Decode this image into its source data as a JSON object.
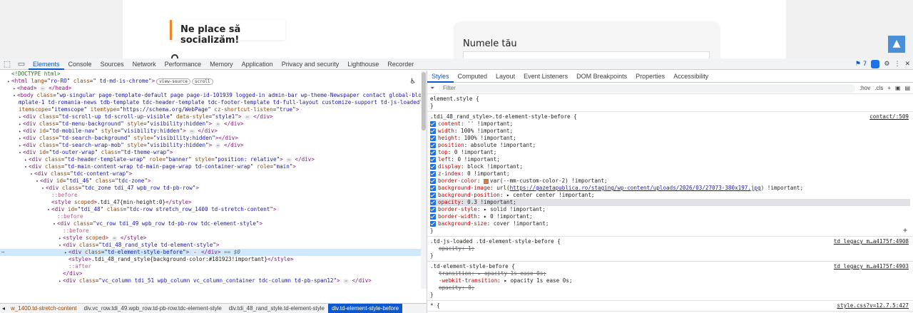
{
  "page": {
    "social_heading": "Ne place să socializăm!",
    "form_label": "Numele tău",
    "scroll_top": "▲"
  },
  "devtools": {
    "tabs": [
      "Elements",
      "Console",
      "Sources",
      "Network",
      "Performance",
      "Memory",
      "Application",
      "Privacy and security",
      "Lighthouse",
      "Recorder"
    ],
    "active_tab": "Elements",
    "issues_count": "7",
    "tree": [
      {
        "indent": 0,
        "html": "<span class='cm'>&lt;!DOCTYPE html&gt;</span>"
      },
      {
        "indent": 0,
        "tw": "▸",
        "html": "<span class='tg'>&lt;html</span> <span class='an'>lang</span>=\"<span class='av'>ro-RO</span>\" <span class='an'>class</span>=\"<span class='av'> td-md-is-chrome</span>\"<span class='tg'>&gt;</span><span class='pill'>view-source</span><span class='pill'>scroll</span>"
      },
      {
        "indent": 1,
        "tw": "▸",
        "html": "<span class='tg'>&lt;head&gt;</span> <span class='ellip'>⋯</span> <span class='tg'>&lt;/head&gt;</span>"
      },
      {
        "indent": 1,
        "tw": "▾",
        "html": "<span class='tg'>&lt;body</span> <span class='an'>class</span>=\"<span class='av'>wp-singular page-template-default page page-id-101939 logged-in admin-bar wp-theme-Newspaper contact global-block-te</span>"
      },
      {
        "indent": 1,
        "cont": true,
        "html": "<span class='av'>mplate-1 td-romania-news tdb-template tdc-header-template tdc-footer-template td-full-layout customize-support td-js-loaded</span>\""
      },
      {
        "indent": 1,
        "cont": true,
        "html": "<span class='an'>itemscope</span>=\"<span class='av'>itemscope</span>\" <span class='an'>itemtype</span>=\"<span class='av'>https://schema.org/WebPage</span>\" <span class='an'>cz-shortcut-listen</span>=\"<span class='av'>true</span>\"<span class='tg'>&gt;</span>"
      },
      {
        "indent": 2,
        "tw": "▸",
        "html": "<span class='tg'>&lt;div</span> <span class='an'>class</span>=\"<span class='av'>td-scroll-up td-scroll-up-visible</span>\" <span class='an'>data-style</span>=\"<span class='av'>style1</span>\"<span class='tg'>&gt;</span> <span class='ellip'>⋯</span> <span class='tg'>&lt;/div&gt;</span>"
      },
      {
        "indent": 2,
        "tw": "▸",
        "html": "<span class='tg'>&lt;div</span> <span class='an'>class</span>=\"<span class='av'>td-menu-background</span>\" <span class='an'>style</span>=\"<span class='av'>visibility:hidden</span>\"<span class='tg'>&gt;</span> <span class='ellip'>⋯</span> <span class='tg'>&lt;/div&gt;</span>"
      },
      {
        "indent": 2,
        "tw": "▸",
        "html": "<span class='tg'>&lt;div</span> <span class='an'>id</span>=\"<span class='av'>td-mobile-nav</span>\" <span class='an'>style</span>=\"<span class='av'>visibility:hidden</span>\"<span class='tg'>&gt;</span> <span class='ellip'>⋯</span> <span class='tg'>&lt;/div&gt;</span>"
      },
      {
        "indent": 2,
        "tw": "▸",
        "html": "<span class='tg'>&lt;div</span> <span class='an'>class</span>=\"<span class='av'>td-search-background</span>\" <span class='an'>style</span>=\"<span class='av'>visibility:hidden</span>\"<span class='tg'>&gt;</span><span class='tg'>&lt;/div&gt;</span>"
      },
      {
        "indent": 2,
        "tw": "▸",
        "html": "<span class='tg'>&lt;div</span> <span class='an'>class</span>=\"<span class='av'>td-search-wrap-mob</span>\" <span class='an'>style</span>=\"<span class='av'>visibility:hidden</span>\"<span class='tg'>&gt;</span> <span class='ellip'>⋯</span> <span class='tg'>&lt;/div&gt;</span>"
      },
      {
        "indent": 2,
        "tw": "▾",
        "html": "<span class='tg'>&lt;div</span> <span class='an'>id</span>=\"<span class='av'>td-outer-wrap</span>\" <span class='an'>class</span>=\"<span class='av'>td-theme-wrap</span>\"<span class='tg'>&gt;</span>"
      },
      {
        "indent": 3,
        "tw": "▸",
        "html": "<span class='tg'>&lt;div</span> <span class='an'>class</span>=\"<span class='av'>td-header-template-wrap</span>\" <span class='an'>role</span>=\"<span class='av'>banner</span>\" <span class='an'>style</span>=\"<span class='av'>position: relative</span>\"<span class='tg'>&gt;</span> <span class='ellip'>⋯</span> <span class='tg'>&lt;/div&gt;</span>"
      },
      {
        "indent": 3,
        "tw": "▾",
        "html": "<span class='tg'>&lt;div</span> <span class='an'>class</span>=\"<span class='av'>td-main-content-wrap td-main-page-wrap td-container-wrap</span>\" <span class='an'>role</span>=\"<span class='av'>main</span>\"<span class='tg'>&gt;</span>"
      },
      {
        "indent": 4,
        "tw": "▾",
        "html": "<span class='tg'>&lt;div</span> <span class='an'>class</span>=\"<span class='av'>tdc-content-wrap</span>\"<span class='tg'>&gt;</span>"
      },
      {
        "indent": 5,
        "tw": "▾",
        "html": "<span class='tg'>&lt;div</span> <span class='an'>id</span>=\"<span class='av'>tdi_46</span>\" <span class='an'>class</span>=\"<span class='av'>tdc-zone</span>\"<span class='tg'>&gt;</span>"
      },
      {
        "indent": 6,
        "tw": "▾",
        "html": "<span class='tg'>&lt;div</span> <span class='an'>class</span>=\"<span class='av'>tdc_zone tdi_47  wpb_row td-pb-row</span>\"<span class='tg'>&gt;</span>"
      },
      {
        "indent": 7,
        "html": "<span class='ps'>::before</span>"
      },
      {
        "indent": 7,
        "html": "<span class='tg'>&lt;style</span> <span class='an'>scoped</span><span class='tg'>&gt;</span>.tdi_47{min-height:0}<span class='tg'>&lt;/style&gt;</span>"
      },
      {
        "indent": 7,
        "tw": "▾",
        "html": "<span class='tg'>&lt;div</span> <span class='an'>id</span>=\"<span class='av'>tdi_48</span>\" <span class='an'>class</span>=\"<span class='av'>tdc-row stretch_row_1400 td-stretch-content</span>\"<span class='tg'>&gt;</span>"
      },
      {
        "indent": 8,
        "html": "<span class='ps'>::before</span>"
      },
      {
        "indent": 8,
        "tw": "▾",
        "html": "<span class='tg'>&lt;div</span> <span class='an'>class</span>=\"<span class='av'>vc_row tdi_49  wpb_row td-pb-row tdc-element-style</span>\"<span class='tg'>&gt;</span>"
      },
      {
        "indent": 9,
        "html": "<span class='ps'>::before</span>"
      },
      {
        "indent": 9,
        "tw": "▸",
        "html": "<span class='tg'>&lt;style</span> <span class='an'>scoped</span><span class='tg'>&gt;</span> <span class='ellip'>⋯</span> <span class='tg'>&lt;/style&gt;</span>"
      },
      {
        "indent": 9,
        "tw": "▾",
        "html": "<span class='tg'>&lt;div</span> <span class='an'>class</span>=\"<span class='av'>tdi_48_rand_style td-element-style</span>\"<span class='tg'>&gt;</span>"
      },
      {
        "indent": 10,
        "tw": "▸",
        "sel": true,
        "html": "<span class='tg'>&lt;div</span> <span class='an'>class</span>=\"<span class='av'>td-element-style-before</span>\"<span class='tg'>&gt;</span> <span class='ellip'>⋯</span> <span class='tg'>&lt;/div&gt;</span> <span class='eq0'>== $0</span>"
      },
      {
        "indent": 10,
        "html": "<span class='tg'>&lt;style&gt;</span>.tdi_48_rand_style{background-color:#181923!important}<span class='tg'>&lt;/style&gt;</span>"
      },
      {
        "indent": 10,
        "html": "<span class='ps'>::after</span>"
      },
      {
        "indent": 9,
        "html": "<span class='tg'>&lt;/div&gt;</span>"
      },
      {
        "indent": 9,
        "tw": "▸",
        "html": "<span class='tg'>&lt;div</span> <span class='an'>class</span>=\"<span class='av'>vc_column tdi_51  wpb_column vc_column_container tdc-column td-pb-span12</span>\"<span class='tg'>&gt;</span> <span class='ellip'>⋯</span> <span class='tg'>&lt;/div&gt;</span>"
      }
    ],
    "breadcrumbs": [
      "w_1400.td-stretch-content",
      "div.vc_row.tdi_49.wpb_row.td-pb-row.tdc-element-style",
      "div.tdi_48_rand_style.td-element-style",
      "div.td-element-style-before"
    ],
    "styles_tabs": [
      "Styles",
      "Computed",
      "Layout",
      "Event Listeners",
      "DOM Breakpoints",
      "Properties",
      "Accessibility"
    ],
    "filter_placeholder": "Filter",
    "filter_tools": [
      ":hov",
      ".cls",
      "+"
    ],
    "element_style_selector": "element.style {",
    "rule1": {
      "selector": ".tdi_48_rand_style>.td-element-style-before {",
      "source": "contact/:509",
      "props": [
        {
          "n": "content",
          "v": "'' !important;"
        },
        {
          "n": "width",
          "v": "100% !important;"
        },
        {
          "n": "height",
          "v": "100% !important;"
        },
        {
          "n": "position",
          "v": "absolute !important;"
        },
        {
          "n": "top",
          "v": "0 !important;"
        },
        {
          "n": "left",
          "v": "0 !important;"
        },
        {
          "n": "display",
          "v": "block !important;"
        },
        {
          "n": "z-index",
          "v": "0 !important;"
        },
        {
          "n": "border-color",
          "v": "var(--mm-custom-color-2) !important;",
          "swatch": "#e07b39"
        },
        {
          "n": "background-image",
          "v": "url(https://gazetapublica.ro/staging/wp-content/uploads/2026/03/27073-380x197.jpg) !important;",
          "link": true
        },
        {
          "n": "background-position",
          "v": "▸ center center !important;"
        },
        {
          "n": "opacity",
          "v": "0.3 !important;",
          "hi": true
        },
        {
          "n": "border-style",
          "v": "▸ solid !important;"
        },
        {
          "n": "border-width",
          "v": "▸ 0 !important;"
        },
        {
          "n": "background-size",
          "v": "cover !important;"
        }
      ]
    },
    "rule2": {
      "selector": ".td-js-loaded .td-element-style-before {",
      "source": "td_legacy_m…a4175f:4908",
      "props": [
        {
          "n": "opacity",
          "v": "1;",
          "strike": true
        }
      ]
    },
    "rule3": {
      "selector": ".td-element-style-before {",
      "source": "td_legacy_m…a4175f:4903",
      "props": [
        {
          "n": "transition",
          "v": "▸ opacity 1s ease 0s;",
          "strike": true
        },
        {
          "n": "-webkit-transition",
          "v": "▸ opacity 1s ease 0s;"
        },
        {
          "n": "opacity",
          "v": "0;",
          "strike": true
        }
      ]
    },
    "rule4": {
      "selector": "* {",
      "source": "style.css?v=12.7.5:427"
    }
  }
}
